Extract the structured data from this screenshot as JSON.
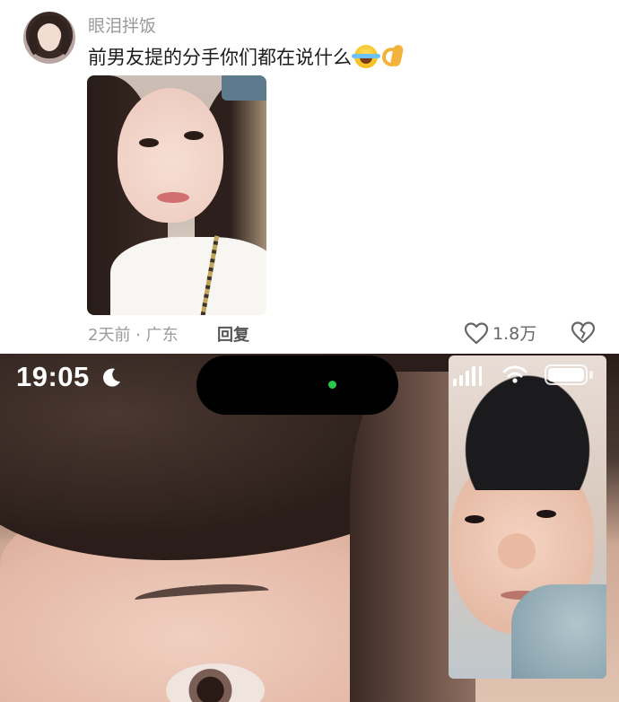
{
  "comment": {
    "username": "眼泪拌饭",
    "text": "前男友提的分手你们都在说什么",
    "emojis": [
      "rolling-laughing-emoji",
      "ok-hand-emoji"
    ],
    "meta": "2天前 · 广东",
    "reply_label": "回复",
    "like_count": "1.8万"
  },
  "call_screenshot": {
    "status_time": "19:05",
    "battery_level": 1.0,
    "signal_bars": 4,
    "camera_indicator_color": "#26c94a"
  },
  "icons": {
    "like": "heart-outline-icon",
    "dislike": "broken-heart-icon",
    "focus": "moon-icon",
    "wifi": "wifi-icon"
  },
  "colors": {
    "username": "#9a9a9a",
    "text": "#1c1c1c",
    "meta": "#9b9b9b"
  }
}
